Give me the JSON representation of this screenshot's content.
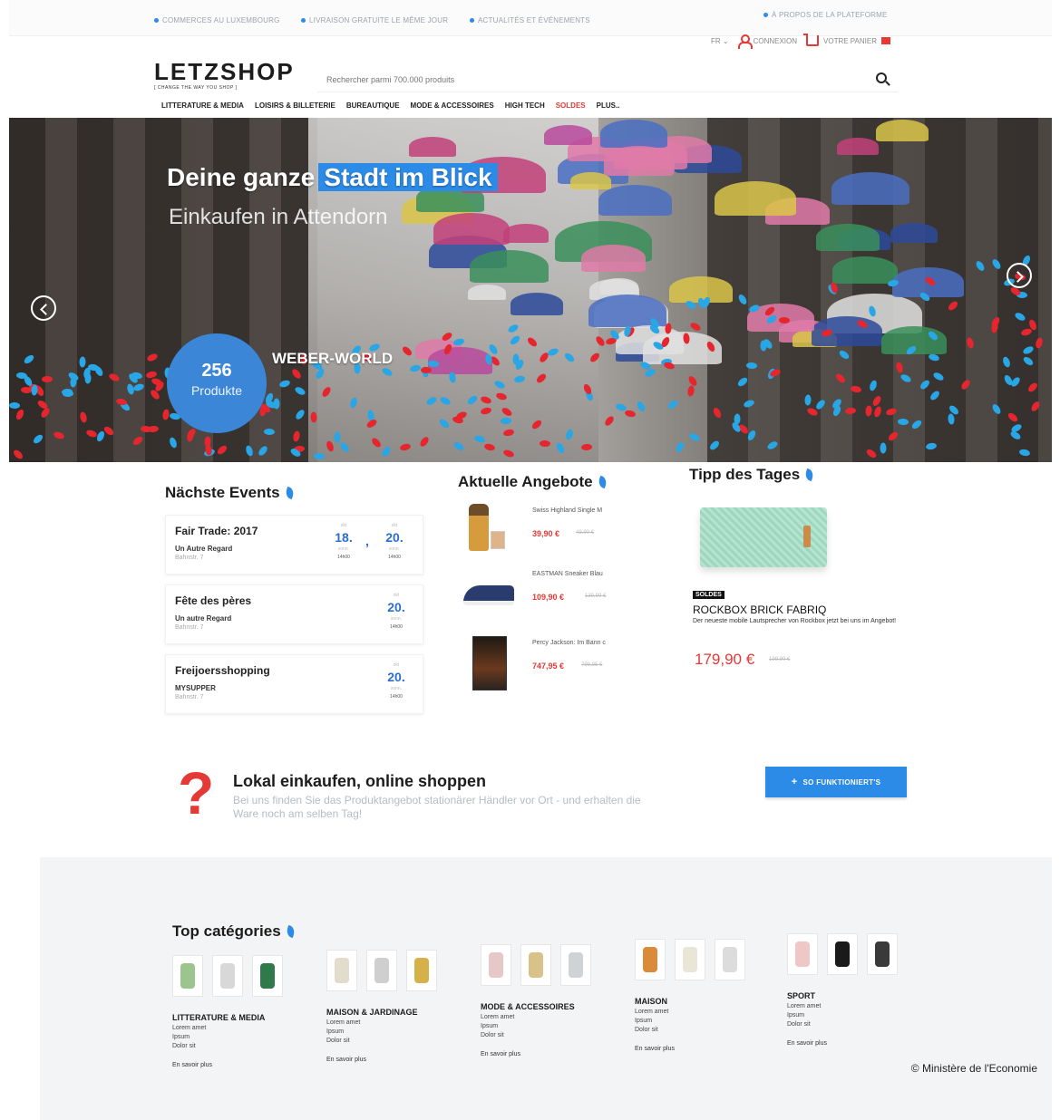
{
  "topbar": {
    "links": [
      "COMMERCES AU LUXEMBOURG",
      "LIVRAISON GRATUITE LE MÊME JOUR",
      "ACTUALITÉS ET ÉVÉNEMENTS",
      "À PROPOS DE LA PLATEFORME"
    ]
  },
  "header": {
    "logo": "LETZSHOP",
    "tagline": "[ CHANGE THE WAY YOU SHOP ]",
    "search_placeholder": "Rechercher parmi 700.000 produits",
    "lang": "FR ⌄",
    "login": "CONNEXION",
    "cart": "VOTRE PANIER",
    "icons": {
      "user": "user-icon",
      "cart": "cart-icon",
      "search": "search-icon"
    },
    "accent": "#e53935"
  },
  "nav": {
    "items": [
      "LITTERATURE & MEDIA",
      "LOISIRS & BILLETERIE",
      "BUREAUTIQUE",
      "MODE & ACCESSOIRES",
      "HIGH TECH",
      "SOLDES",
      "PLUS.."
    ]
  },
  "hero": {
    "title_part1": "Deine ganze",
    "title_part2": "Stadt im Blick",
    "subtitle": "Einkaufen in Attendorn",
    "badge_number": "256",
    "badge_label": "Produkte",
    "shop_name": "WEBER-WORLD",
    "highlight_color": "#2b8be6"
  },
  "events": {
    "heading": "Nächste Events",
    "items": [
      {
        "title": "Fair Trade: 2017",
        "organizer": "Un Autre Regard",
        "address": "Bahnstr. 7",
        "dates": [
          {
            "month": "okt",
            "day": "18.",
            "weekday": "sonn.",
            "time": "14h00"
          },
          {
            "month": "okt",
            "day": "20.",
            "weekday": "sonn.",
            "time": "14h00"
          }
        ]
      },
      {
        "title": "Fête des pères",
        "organizer": "Un autre Regard",
        "address": "Bahnstr. 7",
        "dates": [
          {
            "month": "okt",
            "day": "20.",
            "weekday": "sonn.",
            "time": "14h00"
          }
        ]
      },
      {
        "title": "Freijoersshopping",
        "organizer": "MYSUPPER",
        "address": "Bahnstr. 7",
        "dates": [
          {
            "month": "okt",
            "day": "20.",
            "weekday": "sonn.",
            "time": "14h00"
          }
        ]
      }
    ]
  },
  "offers": {
    "heading": "Aktuelle Angebote",
    "items": [
      {
        "name": "Swiss Highland Single  M",
        "price": "39,90 €",
        "old_price": "49,90 €"
      },
      {
        "name": "EASTMAN  Sneaker Blau",
        "price": "109,90 €",
        "old_price": "139,90 €"
      },
      {
        "name": "Percy Jackson: Im Bann  c",
        "price": "747,95 €",
        "old_price": "799,95 €"
      }
    ]
  },
  "tip": {
    "heading": "Tipp des Tages",
    "badge": "SOLDES",
    "name": "ROCKBOX BRICK FABRIQ",
    "description": "Der neueste mobile Lautsprecher von  Rockbox jetzt bei uns im Angebot!",
    "price": "179,90 €",
    "old_price": "199,90 €"
  },
  "promo": {
    "title": "Lokal einkaufen, online shoppen",
    "text": "Bei uns finden Sie das Produktangebot stationärer Händler  vor Ort - und erhalten die Ware noch am selben Tag!",
    "cta": "SO FUNKTIONIERT'S"
  },
  "categories": {
    "heading": "Top catégories",
    "items": [
      {
        "title": "LITTERATURE & MEDIA",
        "lines": [
          "Lorem amet",
          "Ipsum",
          "Dolor sit"
        ],
        "more": "En savoir plus"
      },
      {
        "title": "MAISON & JARDINAGE",
        "lines": [
          "Lorem amet",
          "Ipsum",
          "Dolor sit"
        ],
        "more": "En savoir plus"
      },
      {
        "title": "MODE & ACCESSOIRES",
        "lines": [
          "Lorem amet",
          "Ipsum",
          "Dolor sit"
        ],
        "more": "En savoir plus"
      },
      {
        "title": "MAISON",
        "lines": [
          "Lorem amet",
          "Ipsum",
          "Dolor sit"
        ],
        "more": "En savoir plus"
      },
      {
        "title": "SPORT",
        "lines": [
          "Lorem amet",
          "Ipsum",
          "Dolor sit"
        ],
        "more": "En savoir plus"
      }
    ]
  },
  "credit": "© Ministère de l'Economie"
}
